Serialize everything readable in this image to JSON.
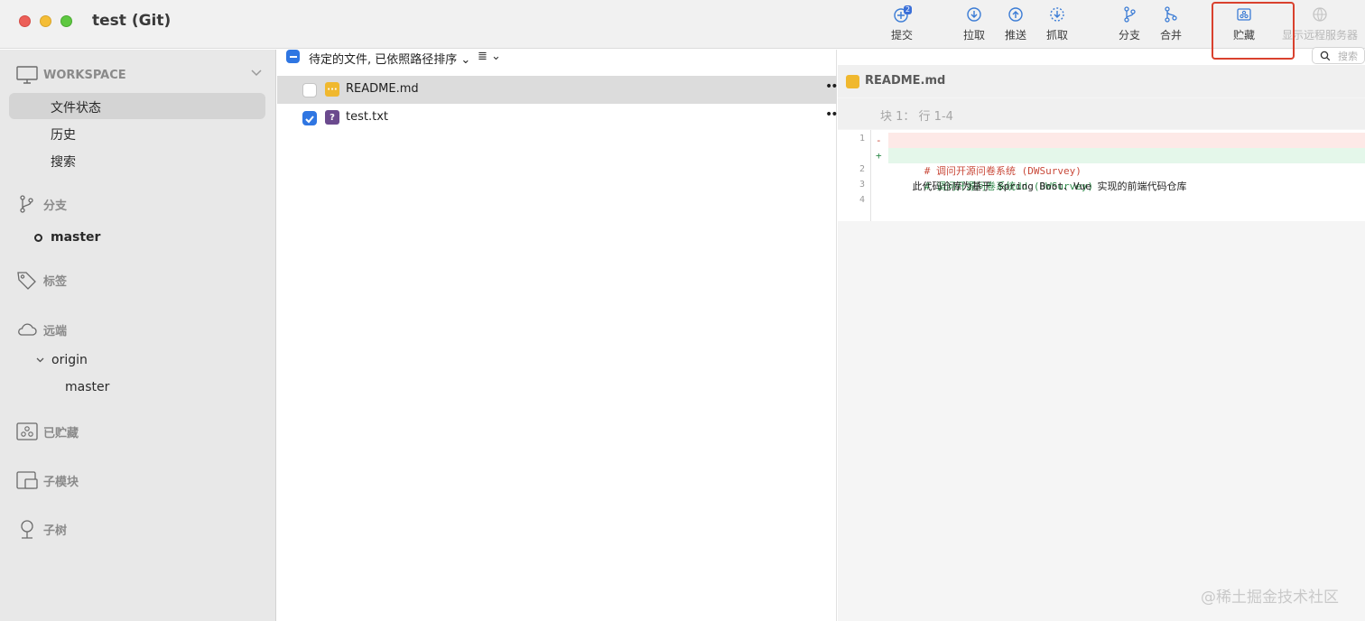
{
  "window": {
    "title": "test (Git)"
  },
  "toolbar": {
    "commit": {
      "label": "提交",
      "badge": "2"
    },
    "pull": {
      "label": "拉取"
    },
    "push": {
      "label": "推送"
    },
    "fetch": {
      "label": "抓取"
    },
    "branch": {
      "label": "分支"
    },
    "merge": {
      "label": "合并"
    },
    "stash": {
      "label": "贮藏"
    },
    "remote": {
      "label": "显示远程服务器"
    }
  },
  "search": {
    "placeholder": "搜索"
  },
  "sidebar": {
    "workspace": {
      "label": "WORKSPACE",
      "items": [
        "文件状态",
        "历史",
        "搜索"
      ]
    },
    "branches": {
      "label": "分支",
      "items": [
        "master"
      ]
    },
    "tags": {
      "label": "标签"
    },
    "remotes": {
      "label": "远端",
      "origin": "origin",
      "items": [
        "master"
      ]
    },
    "stashes": {
      "label": "已贮藏"
    },
    "submodules": {
      "label": "子模块"
    },
    "subtrees": {
      "label": "子树"
    }
  },
  "file_list": {
    "sort_label": "待定的文件, 已依照路径排序",
    "files": [
      {
        "name": "README.md",
        "status": "···",
        "checked": false
      },
      {
        "name": "test.txt",
        "status": "?",
        "checked": true
      }
    ]
  },
  "diff": {
    "file": "README.md",
    "hunk": "块 1： 行 1-4",
    "lines": [
      {
        "n": "1",
        "sign": "-",
        "text": "# 调问开源问卷系统 (DWSurvey)"
      },
      {
        "n": "",
        "sign": "+",
        "text": "# 调问开源问卷系统dd (DWSurvey)"
      },
      {
        "n": "2",
        "sign": "",
        "text": ""
      },
      {
        "n": "3",
        "sign": "",
        "text": "    此代码仓库为基于 Spring Boot、Vue 实现的前端代码仓库"
      },
      {
        "n": "4",
        "sign": "",
        "text": ""
      }
    ]
  },
  "watermark": "@稀土掘金技术社区",
  "colors": {
    "accent": "#2f76e2",
    "highlight": "#d9412e",
    "modified": "#f0b82e"
  }
}
